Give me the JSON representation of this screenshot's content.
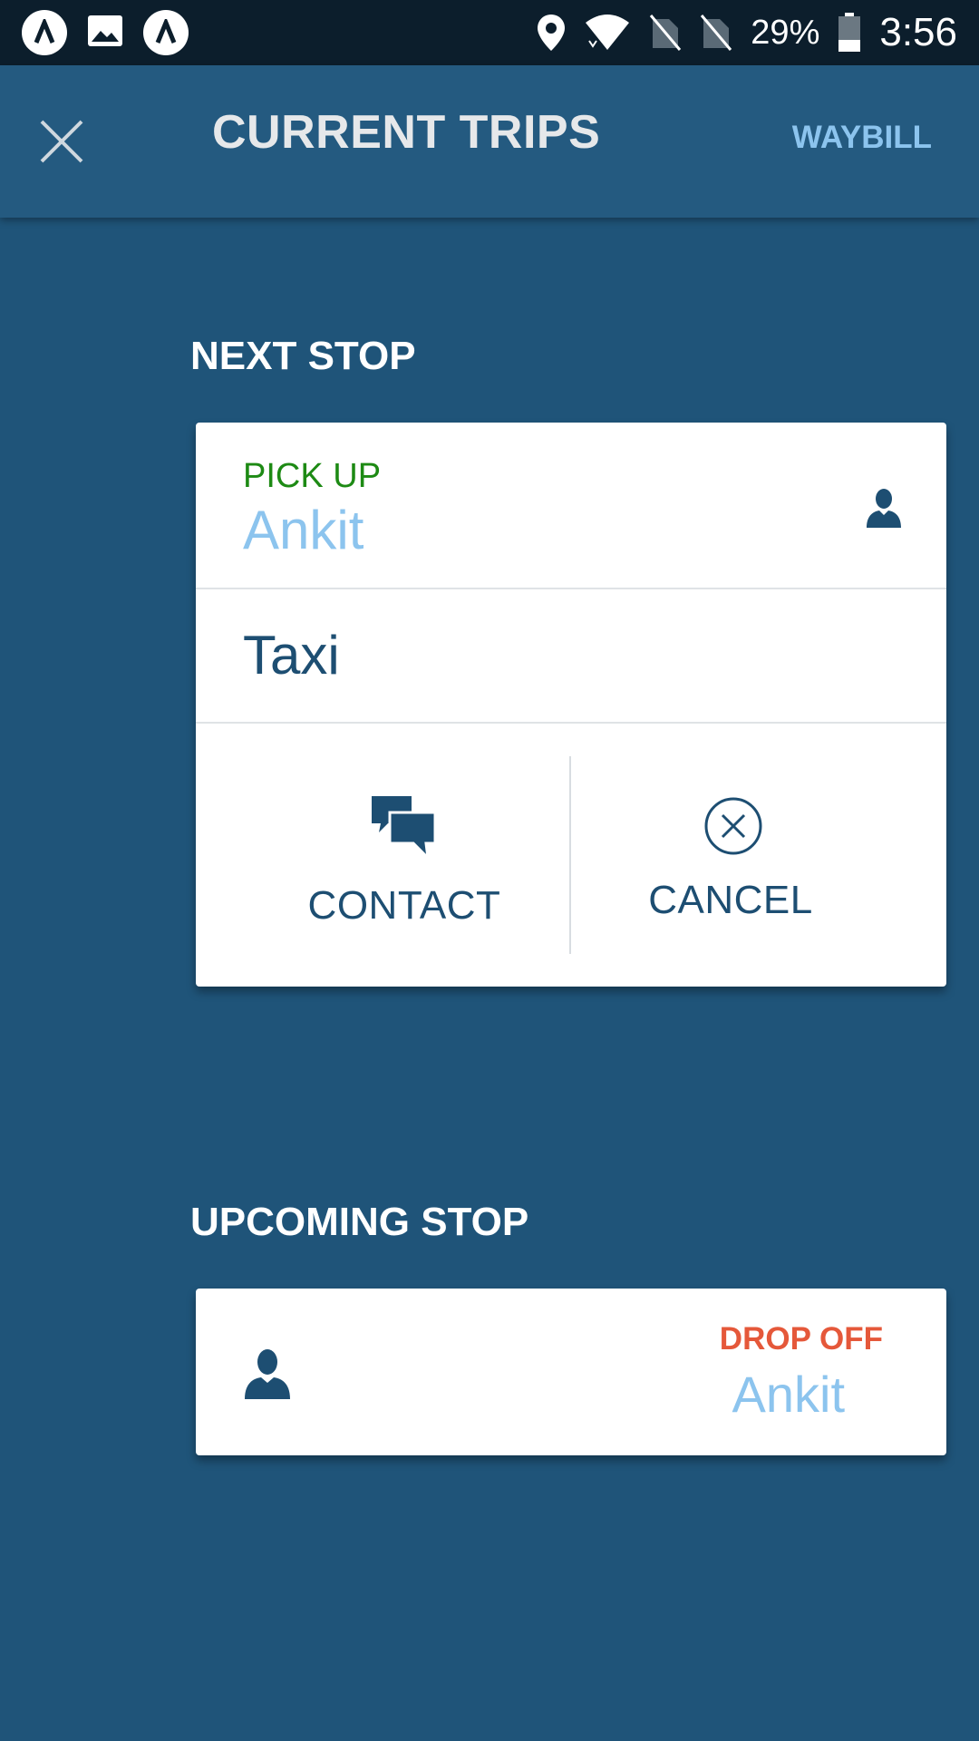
{
  "status_bar": {
    "left_icons": [
      "app-logo-icon",
      "image-icon",
      "app-logo-icon"
    ],
    "right_icons": [
      "location-pin-icon",
      "wifi-icon",
      "no-sim-icon",
      "no-sim-icon",
      "battery-icon"
    ],
    "battery_percent": "29%",
    "time": "3:56"
  },
  "app_bar": {
    "title": "CURRENT TRIPS",
    "action_label": "WAYBILL",
    "close_icon": "close-icon"
  },
  "next_stop": {
    "heading": "NEXT STOP",
    "stop_type": "PICK UP",
    "passenger_name": "Ankit",
    "service": "Taxi",
    "actions": {
      "contact_label": "CONTACT",
      "cancel_label": "CANCEL"
    }
  },
  "upcoming_stop": {
    "heading": "UPCOMING STOP",
    "stop_type": "DROP OFF",
    "passenger_name": "Ankit"
  },
  "colors": {
    "background": "#1f5479",
    "app_bar": "#245a80",
    "status_bar": "#0c1e2c",
    "pickup_green": "#1d8a14",
    "dropoff_orange": "#e5583a",
    "name_light_blue": "#8cc4ee",
    "dark_blue_text": "#1d4e72"
  }
}
